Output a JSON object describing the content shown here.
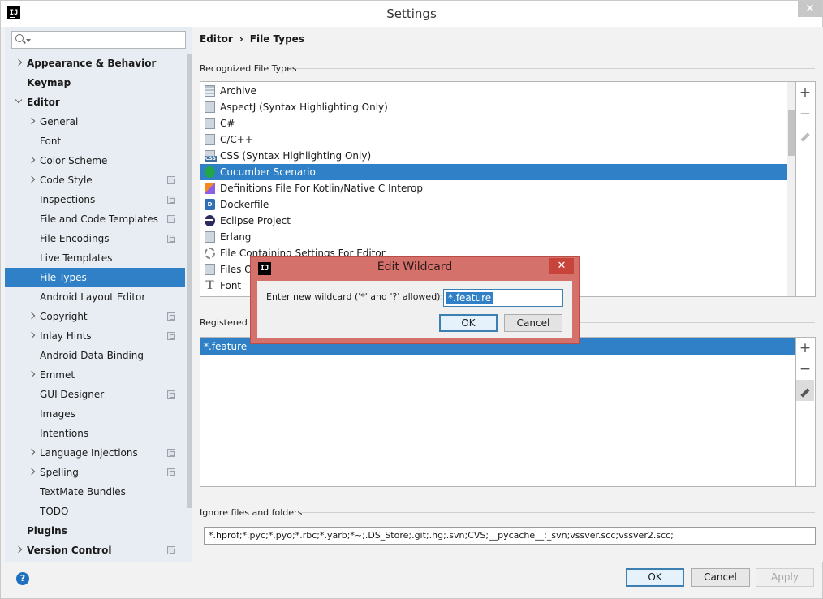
{
  "window": {
    "title": "Settings",
    "app_icon": "IJ",
    "close": "✕"
  },
  "search": {
    "placeholder": ""
  },
  "sidebar": {
    "items": [
      {
        "label": "Appearance & Behavior",
        "level": 0,
        "bold": true,
        "expander": "closed",
        "project": false
      },
      {
        "label": "Keymap",
        "level": 0,
        "bold": true,
        "expander": "none",
        "project": false
      },
      {
        "label": "Editor",
        "level": 0,
        "bold": true,
        "expander": "open",
        "project": false
      },
      {
        "label": "General",
        "level": 1,
        "expander": "closed",
        "project": false
      },
      {
        "label": "Font",
        "level": 1,
        "expander": "none",
        "project": false
      },
      {
        "label": "Color Scheme",
        "level": 1,
        "expander": "closed",
        "project": false
      },
      {
        "label": "Code Style",
        "level": 1,
        "expander": "closed",
        "project": true
      },
      {
        "label": "Inspections",
        "level": 1,
        "expander": "none",
        "project": true
      },
      {
        "label": "File and Code Templates",
        "level": 1,
        "expander": "none",
        "project": true
      },
      {
        "label": "File Encodings",
        "level": 1,
        "expander": "none",
        "project": true
      },
      {
        "label": "Live Templates",
        "level": 1,
        "expander": "none",
        "project": false
      },
      {
        "label": "File Types",
        "level": 1,
        "expander": "none",
        "project": false,
        "selected": true
      },
      {
        "label": "Android Layout Editor",
        "level": 1,
        "expander": "none",
        "project": false
      },
      {
        "label": "Copyright",
        "level": 1,
        "expander": "closed",
        "project": true
      },
      {
        "label": "Inlay Hints",
        "level": 1,
        "expander": "closed",
        "project": true
      },
      {
        "label": "Android Data Binding",
        "level": 1,
        "expander": "none",
        "project": false
      },
      {
        "label": "Emmet",
        "level": 1,
        "expander": "closed",
        "project": false
      },
      {
        "label": "GUI Designer",
        "level": 1,
        "expander": "none",
        "project": true
      },
      {
        "label": "Images",
        "level": 1,
        "expander": "none",
        "project": false
      },
      {
        "label": "Intentions",
        "level": 1,
        "expander": "none",
        "project": false
      },
      {
        "label": "Language Injections",
        "level": 1,
        "expander": "closed",
        "project": true
      },
      {
        "label": "Spelling",
        "level": 1,
        "expander": "closed",
        "project": true
      },
      {
        "label": "TextMate Bundles",
        "level": 1,
        "expander": "none",
        "project": false
      },
      {
        "label": "TODO",
        "level": 1,
        "expander": "none",
        "project": false
      },
      {
        "label": "Plugins",
        "level": 0,
        "bold": true,
        "expander": "none",
        "project": false
      },
      {
        "label": "Version Control",
        "level": 0,
        "bold": true,
        "expander": "closed",
        "project": true
      }
    ]
  },
  "breadcrumb": {
    "parent": "Editor",
    "separator": "›",
    "current": "File Types"
  },
  "recognized": {
    "label": "Recognized File Types",
    "items": [
      {
        "label": "Archive",
        "icon": "archive-icon"
      },
      {
        "label": "AspectJ (Syntax Highlighting Only)",
        "icon": "file-icon"
      },
      {
        "label": "C#",
        "icon": "file-icon"
      },
      {
        "label": "C/C++",
        "icon": "file-icon"
      },
      {
        "label": "CSS (Syntax Highlighting Only)",
        "icon": "css-icon",
        "badge": "CSS"
      },
      {
        "label": "Cucumber Scenario",
        "icon": "cucumber-icon",
        "selected": true
      },
      {
        "label": "Definitions File For Kotlin/Native C Interop",
        "icon": "kotlin-icon"
      },
      {
        "label": "Dockerfile",
        "icon": "docker-icon",
        "badge": "D"
      },
      {
        "label": "Eclipse Project",
        "icon": "eclipse-icon"
      },
      {
        "label": "Erlang",
        "icon": "file-icon"
      },
      {
        "label": "File Containing Settings For Editor",
        "icon": "gear-icon"
      },
      {
        "label": "Files Op",
        "icon": "file-icon"
      },
      {
        "label": "Font",
        "icon": "font-icon",
        "badge": "T"
      }
    ],
    "tools": {
      "add": "+",
      "remove": "−"
    }
  },
  "registered": {
    "label": "Registered P",
    "items": [
      {
        "label": "*.feature",
        "selected": true
      }
    ],
    "tools": {
      "add": "+",
      "remove": "−"
    }
  },
  "ignore": {
    "label": "Ignore files and folders",
    "value": "*.hprof;*.pyc;*.pyo;*.rbc;*.yarb;*~;.DS_Store;.git;.hg;.svn;CVS;__pycache__;_svn;vssver.scc;vssver2.scc;"
  },
  "footer": {
    "help": "?",
    "ok": "OK",
    "cancel": "Cancel",
    "apply": "Apply"
  },
  "dialog": {
    "title": "Edit Wildcard",
    "icon": "IJ",
    "close": "✕",
    "label": "Enter new wildcard ('*' and '?' allowed):",
    "value": "*.feature",
    "ok": "OK",
    "cancel": "Cancel"
  }
}
